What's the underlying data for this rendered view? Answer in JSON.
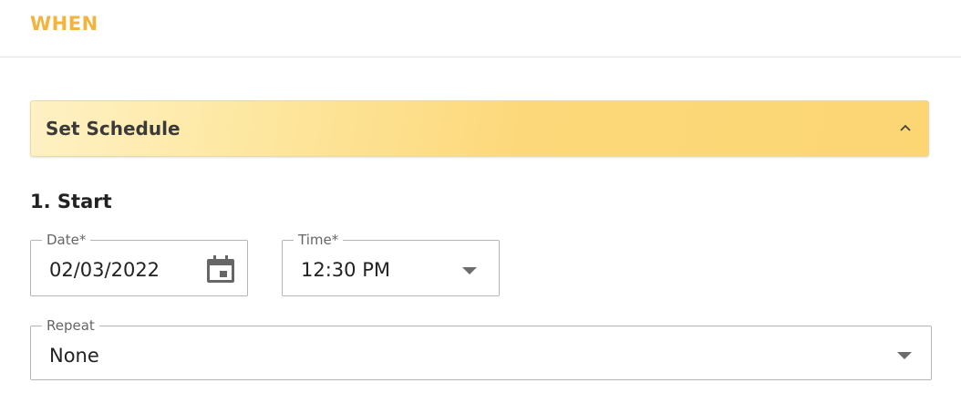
{
  "header": {
    "title": "WHEN"
  },
  "accordion": {
    "label": "Set Schedule",
    "icon": "chevron-up-icon",
    "expanded": true
  },
  "start_section": {
    "title": "1. Start"
  },
  "date_field": {
    "label": "Date",
    "required_mark": "*",
    "value": "02/03/2022",
    "icon": "calendar-icon"
  },
  "time_field": {
    "label": "Time",
    "required_mark": "*",
    "value": "12:30 PM",
    "icon": "dropdown-arrow-icon"
  },
  "repeat_field": {
    "label": "Repeat",
    "value": "None",
    "icon": "dropdown-arrow-icon"
  },
  "colors": {
    "accent": "#f3b33d",
    "accordion_start": "#fff1c4",
    "accordion_end": "#fcd673"
  }
}
